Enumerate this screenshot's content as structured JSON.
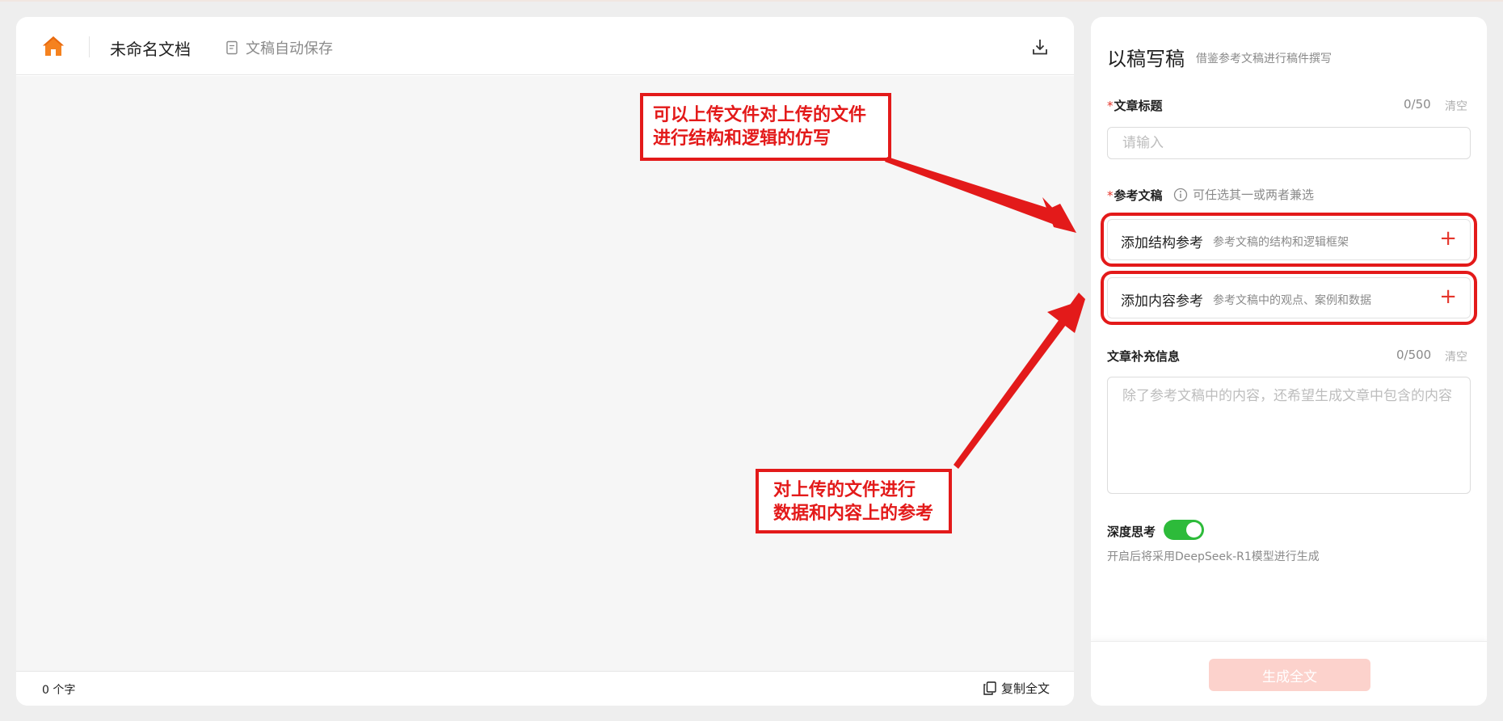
{
  "colors": {
    "accent": "#e5352b",
    "annotation": "#e31a1a",
    "toggle_on": "#2dbb3a",
    "home_icon": "#f5821f",
    "disabled_btn": "#fcd2cc"
  },
  "editor": {
    "home_icon": "home-icon",
    "doc_title": "未命名文档",
    "autosave_label": "文稿自动保存",
    "download_icon": "download-icon",
    "word_count": "0 个字",
    "copy_label": "复制全文"
  },
  "annotations": {
    "upload_structure": [
      "可以上传文件对上传的文件",
      "进行结构和逻辑的仿写"
    ],
    "upload_content": [
      "对上传的文件进行",
      "数据和内容上的参考"
    ]
  },
  "form": {
    "title": "以稿写稿",
    "subtitle": "借鉴参考文稿进行稿件撰写",
    "article_title": {
      "label": "文章标题",
      "required_mark": "*",
      "counter": "0/50",
      "clear": "清空",
      "placeholder": "请输入",
      "value": ""
    },
    "reference": {
      "label": "参考文稿",
      "required_mark": "*",
      "hint": "可任选其一或两者兼选",
      "structure": {
        "title": "添加结构参考",
        "desc": "参考文稿的结构和逻辑框架",
        "action": "+"
      },
      "content": {
        "title": "添加内容参考",
        "desc": "参考文稿中的观点、案例和数据",
        "action": "+"
      }
    },
    "supplement": {
      "label": "文章补充信息",
      "counter": "0/500",
      "clear": "清空",
      "placeholder": "除了参考文稿中的内容，还希望生成文章中包含的内容",
      "value": ""
    },
    "deep_think": {
      "label": "深度思考",
      "enabled": true,
      "desc": "开启后将采用DeepSeek-R1模型进行生成"
    },
    "generate_label": "生成全文"
  }
}
